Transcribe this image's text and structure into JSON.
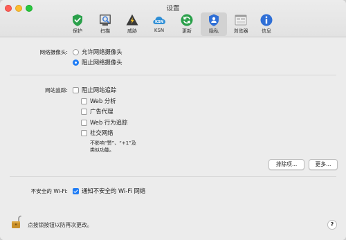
{
  "window": {
    "title": "设置"
  },
  "toolbar": {
    "items": [
      {
        "label": "保护",
        "icon": "shield-icon",
        "color": "#2aa04a"
      },
      {
        "label": "扫描",
        "icon": "scan-icon",
        "color": "#555555"
      },
      {
        "label": "威胁",
        "icon": "threat-icon",
        "color": "#3a3a3a"
      },
      {
        "label": "KSN",
        "icon": "ksn-cloud-icon",
        "color": "#2f8fd6"
      },
      {
        "label": "更新",
        "icon": "update-icon",
        "color": "#2aa04a"
      },
      {
        "label": "隐私",
        "icon": "privacy-icon",
        "color": "#2f6fd6",
        "active": true
      },
      {
        "label": "浏览器",
        "icon": "browser-icon",
        "color": "#8a8a8a"
      },
      {
        "label": "信息",
        "icon": "info-icon",
        "color": "#2f6fd6"
      }
    ]
  },
  "webcam": {
    "label": "网络摄像头:",
    "options": [
      {
        "label": "允许网络摄像头",
        "selected": false
      },
      {
        "label": "阻止网络摄像头",
        "selected": true
      }
    ]
  },
  "tracking": {
    "label": "网站追踪:",
    "block_label": "阻止网站追踪",
    "block_checked": false,
    "sub_options": [
      {
        "label": "Web 分析",
        "checked": false
      },
      {
        "label": "广告代理",
        "checked": false
      },
      {
        "label": "Web 行为追踪",
        "checked": false
      },
      {
        "label": "社交网络",
        "checked": false
      }
    ],
    "social_note_line1": "不影响“赞”、“+1”及",
    "social_note_line2": "类似功能。",
    "exclusions_button": "排除项...",
    "more_button": "更多..."
  },
  "wifi": {
    "label": "不安全的 Wi-Fi:",
    "notify_label": "通知不安全的 Wi-Fi 网络",
    "notify_checked": true
  },
  "footer": {
    "lock_text": "点按锁按钮以防再次更改。",
    "help_label": "?"
  }
}
